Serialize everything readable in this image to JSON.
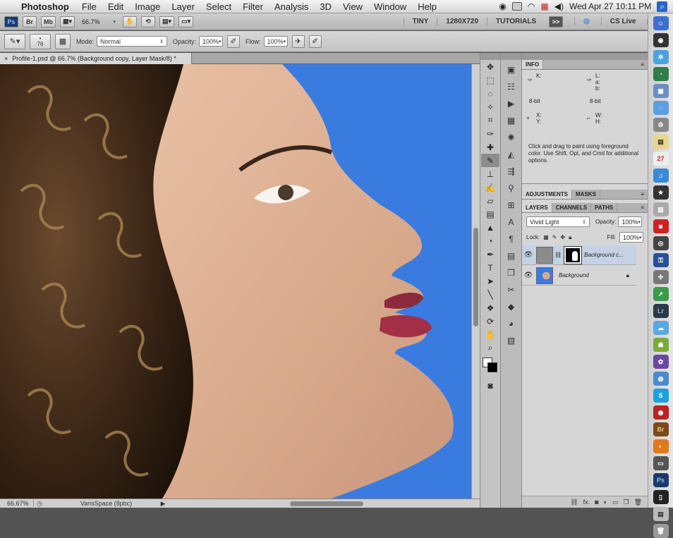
{
  "menubar": {
    "app_name": "Photoshop",
    "items": [
      "File",
      "Edit",
      "Image",
      "Layer",
      "Select",
      "Filter",
      "Analysis",
      "3D",
      "View",
      "Window",
      "Help"
    ],
    "datetime": "Wed Apr 27  10:11 PM"
  },
  "appbar": {
    "br_label": "Br",
    "mb_label": "Mb",
    "zoom": "66.7%",
    "workspaces": [
      "TINY",
      "1280X720",
      "TUTORIALS"
    ],
    "overflow": ">>",
    "cs_live": "CS Live"
  },
  "options": {
    "brush_size": "76",
    "mode_label": "Mode:",
    "mode_value": "Normal",
    "opacity_label": "Opacity:",
    "opacity_value": "100%",
    "flow_label": "Flow:",
    "flow_value": "100%"
  },
  "document": {
    "tab_title": "Profile-1.psd @ 66.7% (Background copy, Layer Mask/8) *"
  },
  "status": {
    "zoom": "66.67%",
    "info": "VarisSpace (8pbc)"
  },
  "info_panel": {
    "tab": "INFO",
    "k_label": "K:",
    "lab_labels": "L:\na:\nb:",
    "bit_left": "8-bit",
    "bit_right": "8-bit",
    "xy_labels": "X:\nY:",
    "wh_labels": "W:\nH:",
    "message": "Click and drag to paint using foreground color.  Use Shift, Opt, and Cmd for additional options."
  },
  "adjust_tabs": [
    "ADJUSTMENTS",
    "MASKS"
  ],
  "layers_panel": {
    "tabs": [
      "LAYERS",
      "CHANNELS",
      "PATHS"
    ],
    "blend_mode": "Vivid Light",
    "opacity_label": "Opacity:",
    "opacity_value": "100%",
    "lock_label": "Lock:",
    "fill_label": "Fill:",
    "fill_value": "100%",
    "layers": [
      {
        "name": "Background c..."
      },
      {
        "name": "Background"
      }
    ],
    "footer_fx": "fx."
  },
  "dock": {
    "lr_label": "Lr",
    "br_label": "Br",
    "ps_label": "Ps"
  },
  "colors": {
    "canvas_bg": "#3a7be0",
    "selected_layer": "#c4d2e4"
  }
}
